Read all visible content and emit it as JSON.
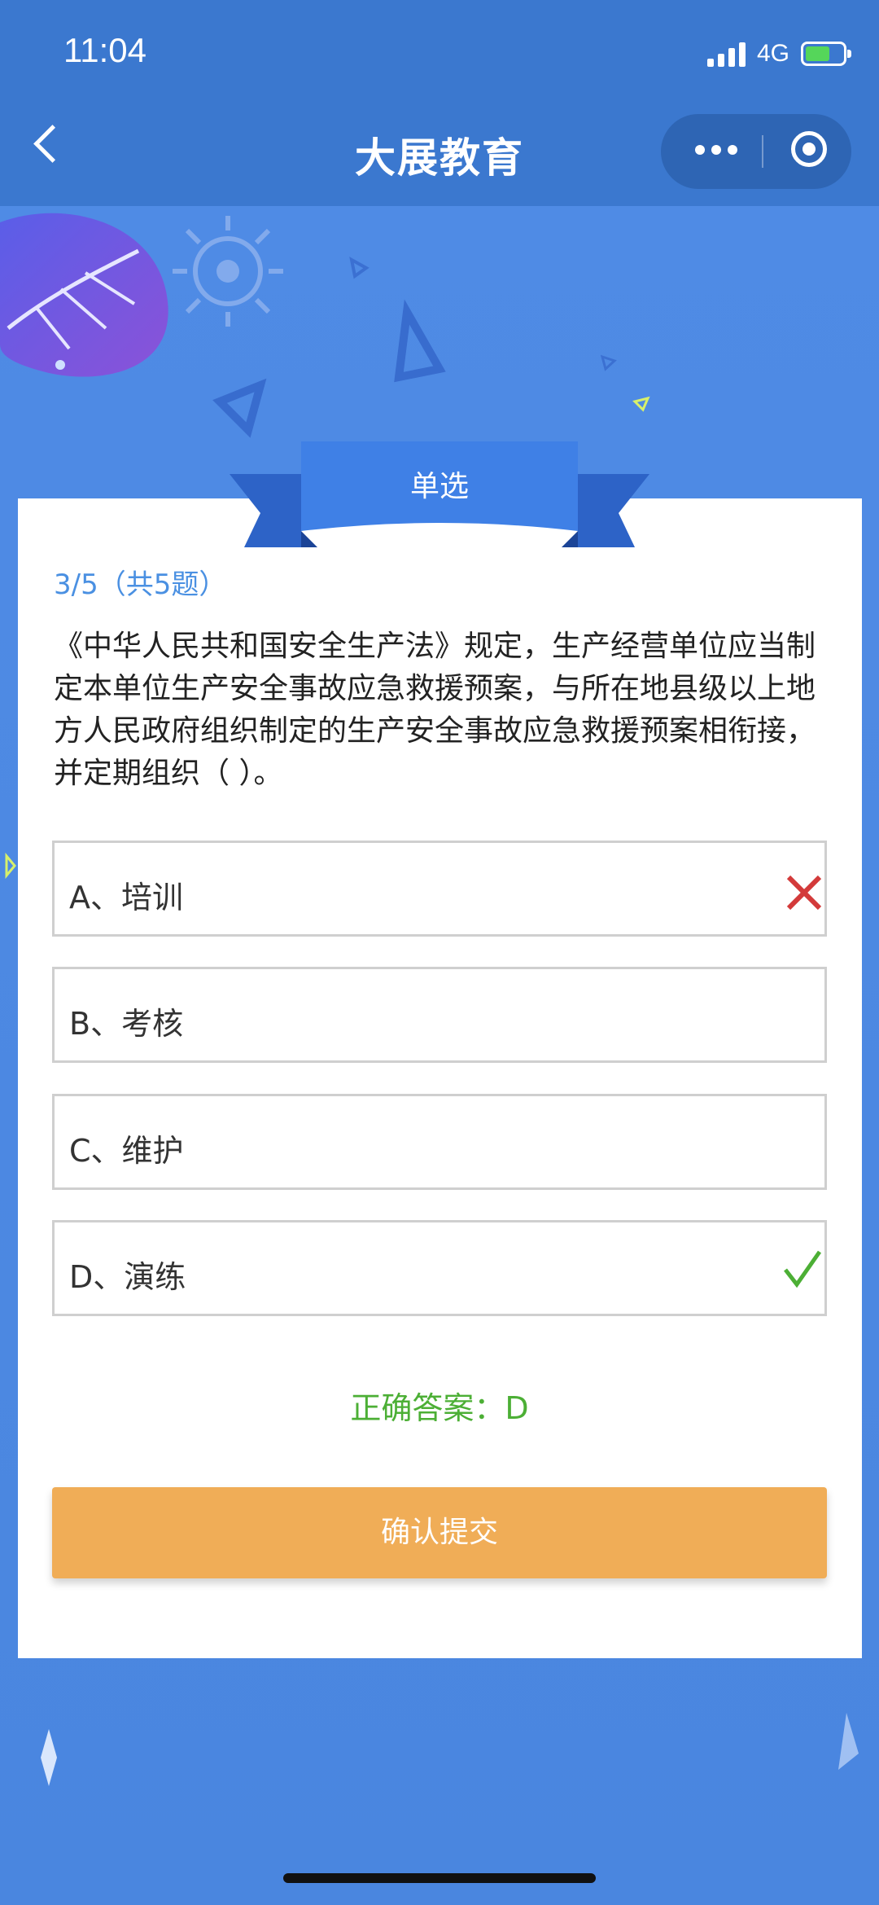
{
  "status_bar": {
    "time": "11:04",
    "network": "4G"
  },
  "nav": {
    "title": "大展教育"
  },
  "quiz": {
    "type_label": "单选",
    "progress": "3/5（共5题）",
    "question": "《中华人民共和国安全生产法》规定，生产经营单位应当制定本单位生产安全事故应急救援预案，与所在地县级以上地方人民政府组织制定的生产安全事故应急救援预案相衔接，并定期组织（ ）。",
    "options": [
      {
        "label": "A、培训",
        "state": "wrong"
      },
      {
        "label": "B、考核",
        "state": "none"
      },
      {
        "label": "C、维护",
        "state": "none"
      },
      {
        "label": "D、演练",
        "state": "correct"
      }
    ],
    "correct_answer": "正确答案：D",
    "submit_label": "确认提交"
  },
  "colors": {
    "nav_bg": "#3b78cf",
    "page_bg": "#4b86e2",
    "accent_blue": "#4a90e2",
    "correct_green": "#4caf35",
    "wrong_red": "#d33a3a",
    "submit_orange": "#f0ad57"
  },
  "icons": [
    "back-icon",
    "more-icon",
    "target-icon",
    "wrong-icon",
    "correct-icon"
  ]
}
